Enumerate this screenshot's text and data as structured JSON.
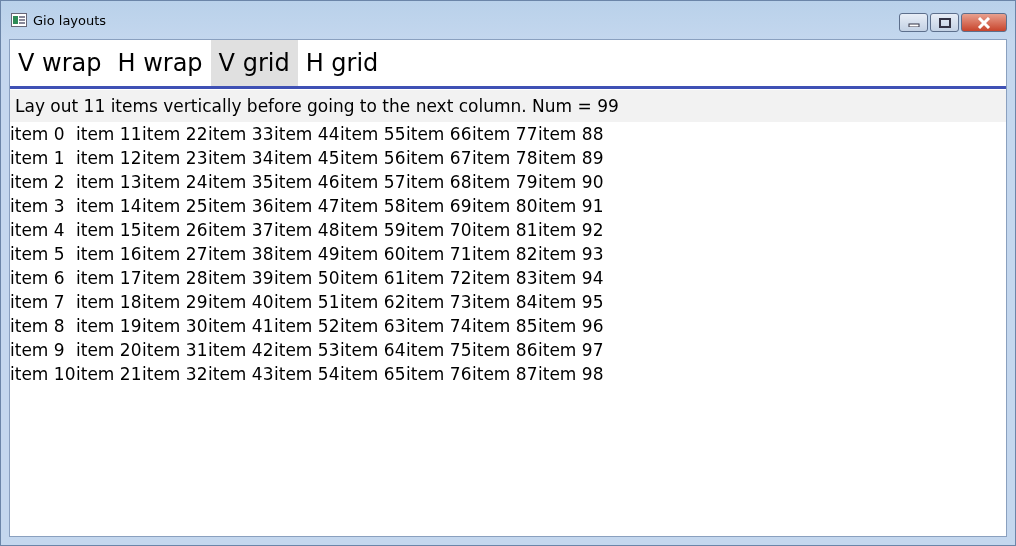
{
  "window": {
    "title": "Gio layouts"
  },
  "tabs": [
    {
      "label": "V wrap",
      "selected": false
    },
    {
      "label": "H wrap",
      "selected": false
    },
    {
      "label": "V grid",
      "selected": true
    },
    {
      "label": "H grid",
      "selected": false
    }
  ],
  "description": "Lay out 11 items vertically before going to the next column. Num = 99",
  "items": [
    "item 0",
    "item 1",
    "item 2",
    "item 3",
    "item 4",
    "item 5",
    "item 6",
    "item 7",
    "item 8",
    "item 9",
    "item 10",
    "item 11",
    "item 12",
    "item 13",
    "item 14",
    "item 15",
    "item 16",
    "item 17",
    "item 18",
    "item 19",
    "item 20",
    "item 21",
    "item 22",
    "item 23",
    "item 24",
    "item 25",
    "item 26",
    "item 27",
    "item 28",
    "item 29",
    "item 30",
    "item 31",
    "item 32",
    "item 33",
    "item 34",
    "item 35",
    "item 36",
    "item 37",
    "item 38",
    "item 39",
    "item 40",
    "item 41",
    "item 42",
    "item 43",
    "item 44",
    "item 45",
    "item 46",
    "item 47",
    "item 48",
    "item 49",
    "item 50",
    "item 51",
    "item 52",
    "item 53",
    "item 54",
    "item 55",
    "item 56",
    "item 57",
    "item 58",
    "item 59",
    "item 60",
    "item 61",
    "item 62",
    "item 63",
    "item 64",
    "item 65",
    "item 66",
    "item 67",
    "item 68",
    "item 69",
    "item 70",
    "item 71",
    "item 72",
    "item 73",
    "item 74",
    "item 75",
    "item 76",
    "item 77",
    "item 78",
    "item 79",
    "item 80",
    "item 81",
    "item 82",
    "item 83",
    "item 84",
    "item 85",
    "item 86",
    "item 87",
    "item 88",
    "item 89",
    "item 90",
    "item 91",
    "item 92",
    "item 93",
    "item 94",
    "item 95",
    "item 96",
    "item 97",
    "item 98"
  ]
}
